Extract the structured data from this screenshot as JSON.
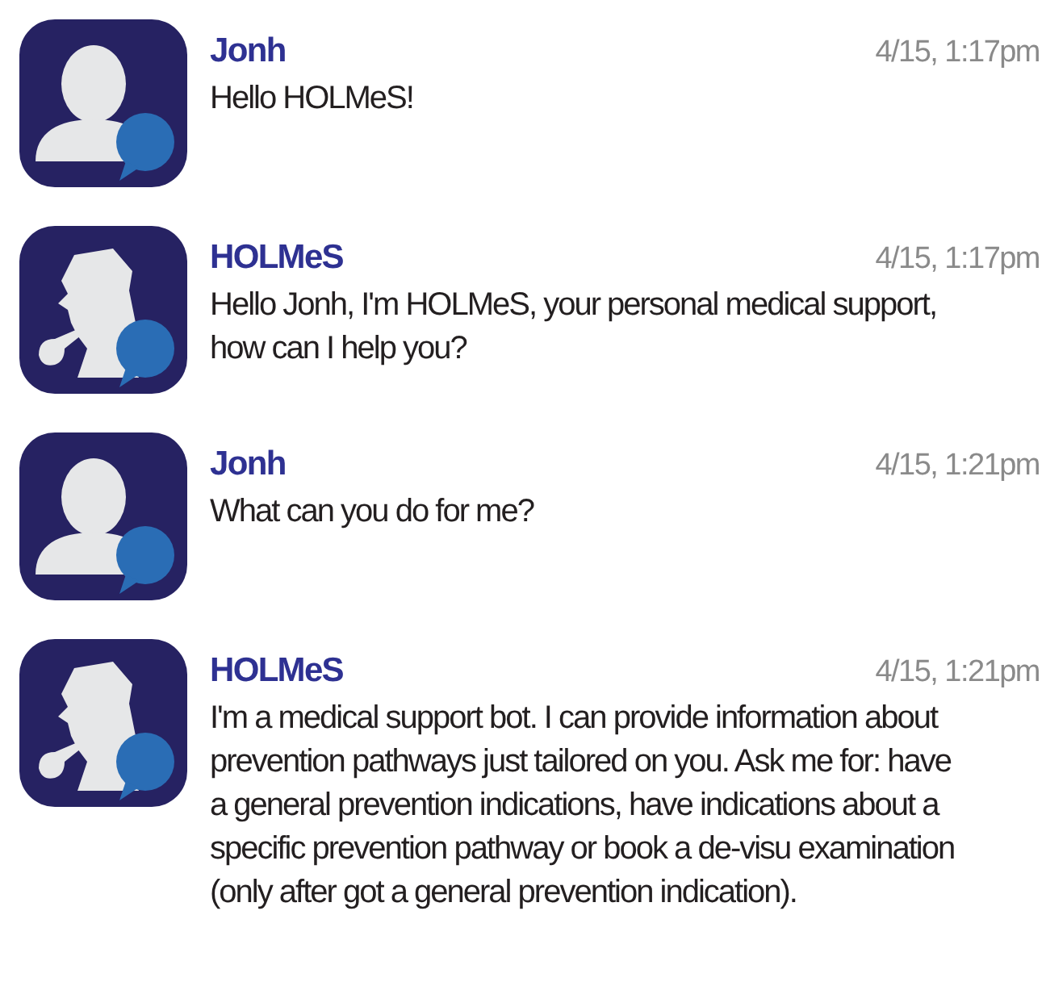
{
  "messages": [
    {
      "kind": "user",
      "sender": "Jonh",
      "time": "4/15, 1:17pm",
      "text": "Hello HOLMeS!"
    },
    {
      "kind": "bot",
      "sender": "HOLMeS",
      "time": "4/15, 1:17pm",
      "text": "Hello Jonh, I'm HOLMeS, your personal medical support, how can I help you?"
    },
    {
      "kind": "user",
      "sender": "Jonh",
      "time": "4/15, 1:21pm",
      "text": "What can you do for me?"
    },
    {
      "kind": "bot",
      "sender": "HOLMeS",
      "time": "4/15, 1:21pm",
      "text": "I'm a medical support bot. I can provide information about prevention pathways just tailored on you. Ask me for: have a general prevention indications, have indications about a specific prevention pathway or book a de-visu examination (only after got a general prevention indication)."
    }
  ]
}
